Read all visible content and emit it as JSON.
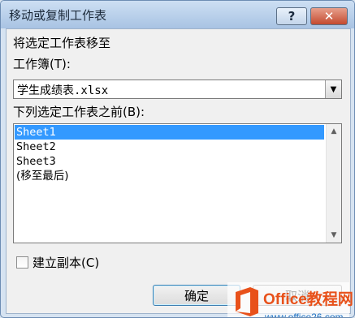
{
  "window": {
    "title": "移动或复制工作表",
    "help_label": "?",
    "close_label": "✕"
  },
  "labels": {
    "move_to": "将选定工作表移至",
    "workbook": "工作簿(T):",
    "before_sheet": "下列选定工作表之前(B):",
    "create_copy": "建立副本(C)"
  },
  "workbook_select": {
    "value": "学生成绩表.xlsx"
  },
  "sheets": [
    {
      "label": "Sheet1",
      "selected": true
    },
    {
      "label": "Sheet2",
      "selected": false
    },
    {
      "label": "Sheet3",
      "selected": false
    },
    {
      "label": "(移至最后)",
      "selected": false
    }
  ],
  "checkbox": {
    "checked": false
  },
  "buttons": {
    "ok": "确定",
    "cancel": "取消"
  },
  "watermark": {
    "brand_text": "Office教程网",
    "url_text": "www.office26.com"
  },
  "colors": {
    "selection": "#3399ff",
    "brand_orange": "#e8511a"
  }
}
